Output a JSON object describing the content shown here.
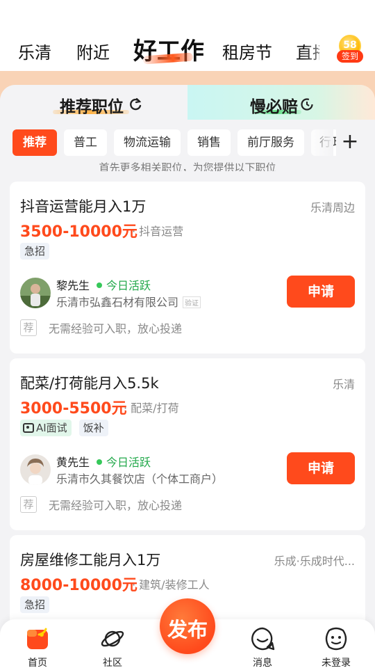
{
  "top_nav": {
    "tabs": [
      "乐清",
      "附近",
      "好工作",
      "租房节",
      "直播"
    ],
    "active_tab": "好工作",
    "signin": {
      "coin_text": "58",
      "badge": "签到"
    }
  },
  "segments": {
    "left": "推荐职位",
    "right": "慢必赔"
  },
  "chips": [
    "推荐",
    "普工",
    "物流运输",
    "销售",
    "前厅服务",
    "行政"
  ],
  "chips_plus": "+",
  "hint_text": "首先更多相关职位，为您提供以下职位",
  "jobs": [
    {
      "title": "抖音运营能月入1万",
      "location": "乐清周边",
      "salary": "3500-10000元",
      "category": "· 抖音运营",
      "tags": [
        "急招"
      ],
      "contact": "黎先生",
      "status": "今日活跃",
      "company": "乐清市弘鑫石材有限公司",
      "verify": "验证",
      "apply": "申请",
      "rec_icon": "荐",
      "rec_text": "无需经验可入职，放心投递"
    },
    {
      "title": "配菜/打荷能月入5.5k",
      "location": "乐清",
      "salary": "3000-5500元",
      "category": "· 配菜/打荷",
      "tags": [
        "AI面试",
        "饭补"
      ],
      "contact": "黄先生",
      "status": "今日活跃",
      "company": "乐清市久其餐饮店（个体工商户）",
      "apply": "申请",
      "rec_icon": "荐",
      "rec_text": "无需经验可入职，放心投递"
    },
    {
      "title": "房屋维修工能月入1万",
      "location": "乐成·乐成时代...",
      "salary": "8000-10000元",
      "category": "· 建筑/装修工人",
      "tags": [
        "急招"
      ]
    }
  ],
  "bottom_nav": {
    "items": [
      "首页",
      "社区",
      "消息",
      "未登录"
    ],
    "publish": "发布"
  },
  "colors": {
    "accent": "#ff4a1c",
    "active_green": "#36c85a",
    "band": "#f9d3b6"
  }
}
